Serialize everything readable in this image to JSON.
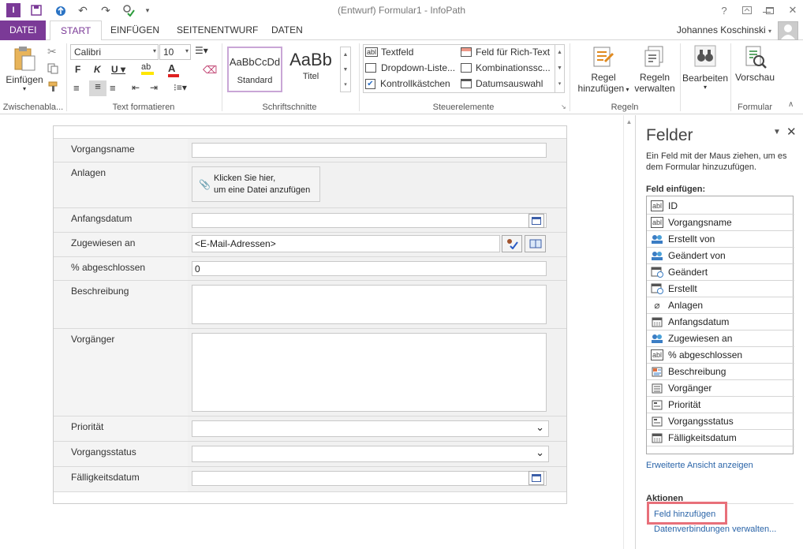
{
  "window": {
    "title": "(Entwurf) Formular1 - InfoPath",
    "help": "?"
  },
  "tabs": [
    "DATEI",
    "START",
    "EINFÜGEN",
    "SEITENENTWURF",
    "DATEN"
  ],
  "user": {
    "name": "Johannes Koschinski"
  },
  "ribbon": {
    "clipboard": {
      "paste_label": "Einfügen",
      "group_label": "Zwischenabla..."
    },
    "text": {
      "font": "Calibri",
      "size": "10",
      "group_label": "Text formatieren"
    },
    "styles": {
      "standard_sample": "AaBbCcDd",
      "standard_label": "Standard",
      "title_sample": "AaBb",
      "title_label": "Titel",
      "group_label": "Schriftschnitte"
    },
    "controls": {
      "items": [
        "Textfeld",
        "Dropdown-Liste...",
        "Kontrollkästchen",
        "Feld für Rich-Text",
        "Kombinationssc...",
        "Datumsauswahl"
      ],
      "group_label": "Steuerelemente"
    },
    "rules": {
      "add_rule_line1": "Regel",
      "add_rule_line2": "hinzufügen",
      "manage_line1": "Regeln",
      "manage_line2": "verwalten",
      "group_label": "Regeln"
    },
    "edit": {
      "label": "Bearbeiten"
    },
    "form": {
      "preview_label": "Vorschau",
      "group_label": "Formular"
    }
  },
  "form": {
    "fields": {
      "name": "Vorgangsname",
      "attach": "Anlagen",
      "attach_hint_1": "Klicken Sie hier,",
      "attach_hint_2": "um eine Datei anzufügen",
      "start": "Anfangsdatum",
      "assigned": "Zugewiesen an",
      "assigned_value": "<E-Mail-Adressen>",
      "percent": "% abgeschlossen",
      "percent_value": "0",
      "desc": "Beschreibung",
      "pred": "Vorgänger",
      "priority": "Priorität",
      "status": "Vorgangsstatus",
      "due": "Fälligkeitsdatum"
    }
  },
  "pane": {
    "title": "Felder",
    "desc": "Ein Feld mit der Maus ziehen, um es dem Formular hinzuzufügen.",
    "insert_label": "Feld einfügen:",
    "fields": [
      {
        "label": "ID",
        "icon": "text-field-icon"
      },
      {
        "label": "Vorgangsname",
        "icon": "text-field-icon"
      },
      {
        "label": "Erstellt von",
        "icon": "people-icon"
      },
      {
        "label": "Geändert von",
        "icon": "people-icon"
      },
      {
        "label": "Geändert",
        "icon": "date-time-icon"
      },
      {
        "label": "Erstellt",
        "icon": "date-time-icon"
      },
      {
        "label": "Anlagen",
        "icon": "paperclip-icon"
      },
      {
        "label": "Anfangsdatum",
        "icon": "calendar-icon"
      },
      {
        "label": "Zugewiesen an",
        "icon": "people-icon"
      },
      {
        "label": "% abgeschlossen",
        "icon": "text-field-icon"
      },
      {
        "label": "Beschreibung",
        "icon": "rich-text-icon"
      },
      {
        "label": "Vorgänger",
        "icon": "list-icon"
      },
      {
        "label": "Priorität",
        "icon": "dropdown-icon"
      },
      {
        "label": "Vorgangsstatus",
        "icon": "dropdown-icon"
      },
      {
        "label": "Fälligkeitsdatum",
        "icon": "calendar-icon"
      }
    ],
    "advanced_link": "Erweiterte Ansicht anzeigen",
    "actions_label": "Aktionen",
    "add_field_link": "Feld hinzufügen",
    "data_connections_link": "Datenverbindungen verwalten..."
  }
}
